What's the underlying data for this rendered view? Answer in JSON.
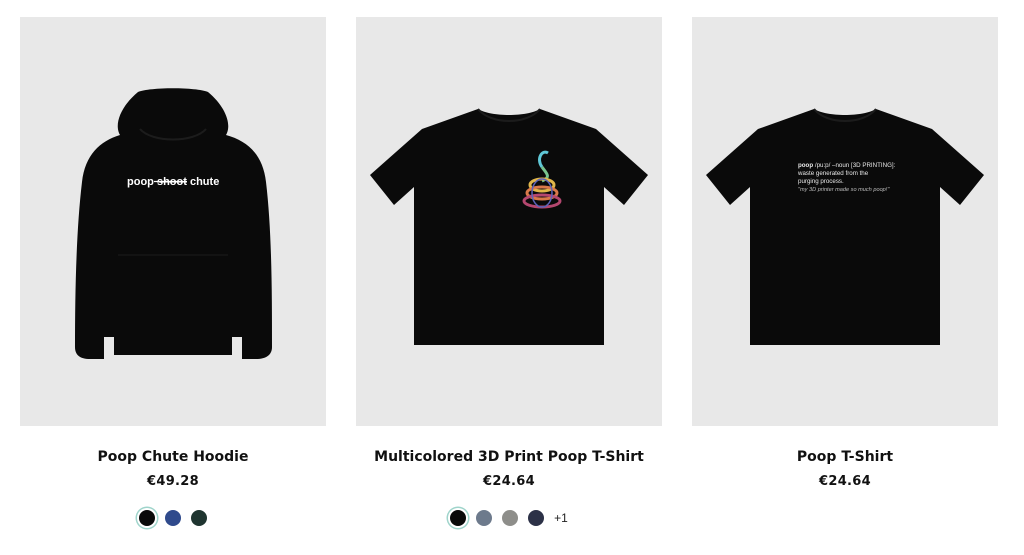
{
  "products": [
    {
      "title": "Poop Chute Hoodie",
      "price": "€49.28",
      "print_text": {
        "word1": "poop",
        "word2": "shoot",
        "word3": "chute"
      },
      "swatches": [
        {
          "color": "#0a0a0a",
          "selected": true
        },
        {
          "color": "#2f4a8c",
          "selected": false
        },
        {
          "color": "#1f3530",
          "selected": false
        }
      ]
    },
    {
      "title": "Multicolored 3D Print Poop T-Shirt",
      "price": "€24.64",
      "swatches": [
        {
          "color": "#0a0a0a",
          "selected": true
        },
        {
          "color": "#6d7a8c",
          "selected": false
        },
        {
          "color": "#8e8e8a",
          "selected": false
        },
        {
          "color": "#2c3147",
          "selected": false
        }
      ],
      "more_colors": "+1"
    },
    {
      "title": "Poop T-Shirt",
      "price": "€24.64",
      "print_text": {
        "line1_word": "poop",
        "line1_rest": " /pu:p/ –noun [3D PRINTING]:",
        "line2": "waste generated from the",
        "line3": "purging process.",
        "line4": "\"my 3D printer made so much poop!\""
      }
    }
  ],
  "colors": {
    "image_bg": "#e8e8e8",
    "garment": "#0a0a0a",
    "selected_ring": "#9fd4cb"
  }
}
